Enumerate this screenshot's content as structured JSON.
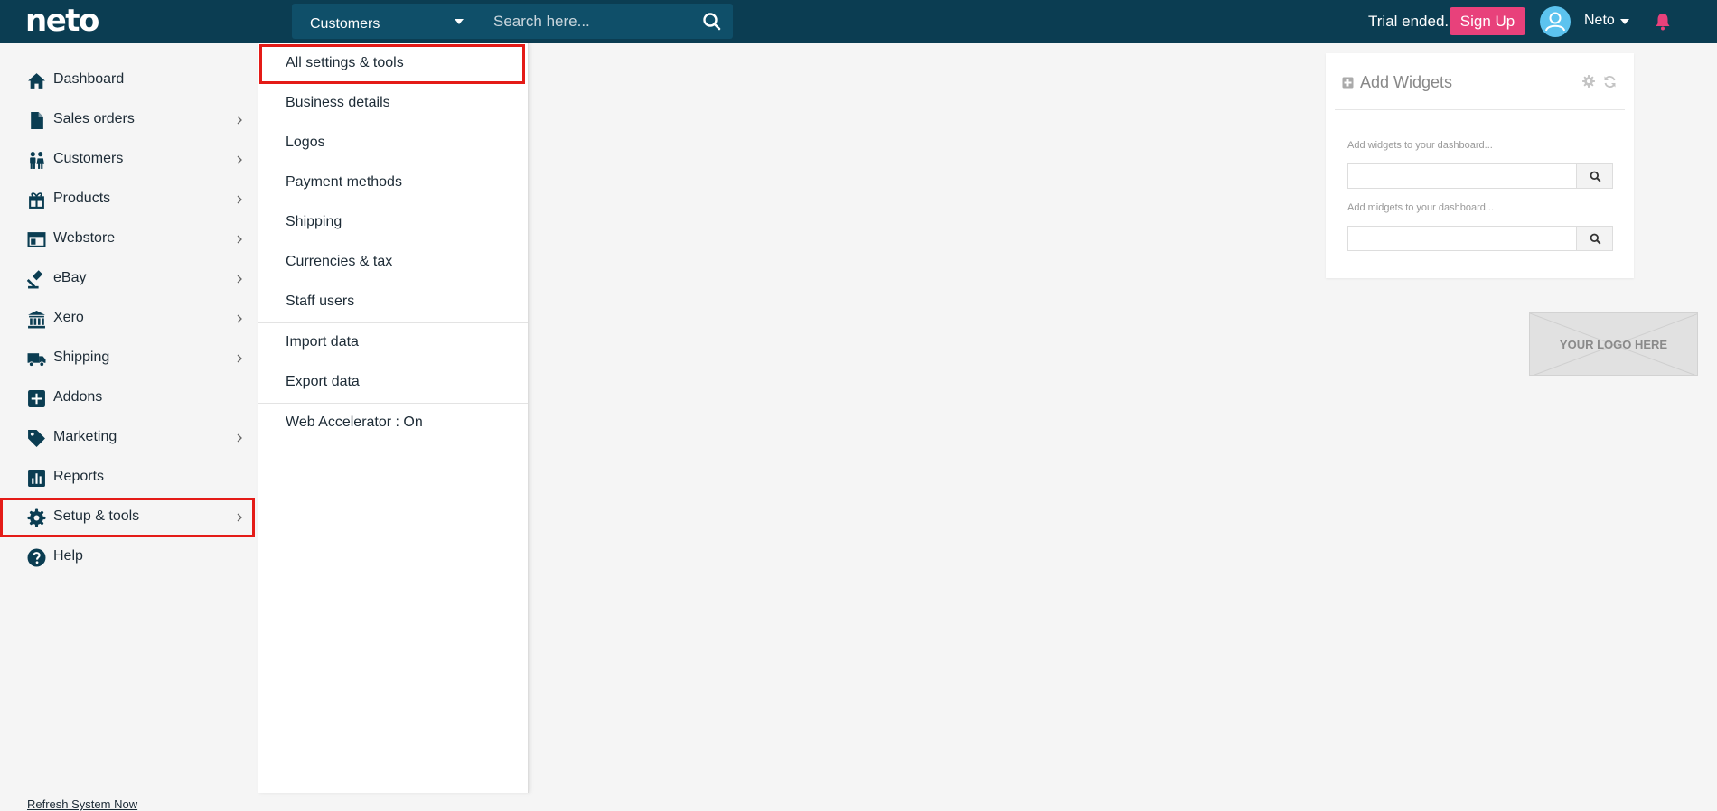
{
  "header": {
    "logo_text": "neto",
    "search_scope": "Customers",
    "search_placeholder": "Search here...",
    "trial_text": "Trial ended.",
    "signup_label": "Sign Up",
    "user_name": "Neto"
  },
  "sidebar": {
    "items": [
      {
        "label": "Dashboard",
        "icon": "home-icon",
        "has_submenu": false
      },
      {
        "label": "Sales orders",
        "icon": "document-icon",
        "has_submenu": true
      },
      {
        "label": "Customers",
        "icon": "users-icon",
        "has_submenu": true
      },
      {
        "label": "Products",
        "icon": "gift-icon",
        "has_submenu": true
      },
      {
        "label": "Webstore",
        "icon": "window-icon",
        "has_submenu": true
      },
      {
        "label": "eBay",
        "icon": "gavel-icon",
        "has_submenu": true
      },
      {
        "label": "Xero",
        "icon": "bank-icon",
        "has_submenu": true
      },
      {
        "label": "Shipping",
        "icon": "truck-icon",
        "has_submenu": true
      },
      {
        "label": "Addons",
        "icon": "plus-square-icon",
        "has_submenu": false
      },
      {
        "label": "Marketing",
        "icon": "tag-icon",
        "has_submenu": true
      },
      {
        "label": "Reports",
        "icon": "bar-chart-icon",
        "has_submenu": false
      },
      {
        "label": "Setup & tools",
        "icon": "gear-icon",
        "has_submenu": true,
        "active": true
      },
      {
        "label": "Help",
        "icon": "help-icon",
        "has_submenu": false
      }
    ],
    "refresh_label": "Refresh System Now"
  },
  "setup_menu": {
    "items": [
      {
        "label": "All settings & tools",
        "active": true
      },
      {
        "label": "Business details"
      },
      {
        "label": "Logos"
      },
      {
        "label": "Payment methods"
      },
      {
        "label": "Shipping"
      },
      {
        "label": "Currencies & tax"
      },
      {
        "label": "Staff users"
      },
      {
        "label": "Import data"
      },
      {
        "label": "Export data"
      },
      {
        "label": "Web Accelerator : On"
      }
    ]
  },
  "widgets": {
    "title": "Add Widgets",
    "widget_label": "Add widgets to your dashboard...",
    "midget_label": "Add midgets to your dashboard..."
  },
  "logo_placeholder": {
    "text": "YOUR LOGO HERE"
  },
  "colors": {
    "header_bg": "#0b3d52",
    "accent_pink": "#e8417b",
    "highlight_red": "#e41b17",
    "avatar_blue": "#5cc3ef"
  }
}
